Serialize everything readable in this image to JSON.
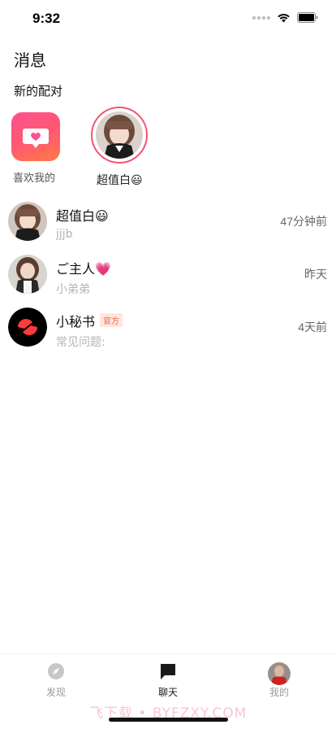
{
  "status_bar": {
    "time": "9:32"
  },
  "page": {
    "title": "消息"
  },
  "new_matches": {
    "section_title": "新的配对",
    "likes_label": "喜欢我的",
    "match_name": "超值白😃"
  },
  "chats": [
    {
      "name": "超值白😃",
      "preview": "jjjb",
      "time": "47分钟前"
    },
    {
      "name": "ご主人💗",
      "preview": "小弟弟",
      "time": "昨天"
    },
    {
      "name": "小秘书",
      "badge": "官方",
      "preview": "常见问题:",
      "time": "4天前"
    }
  ],
  "tab_bar": {
    "tabs": [
      {
        "label": "发现"
      },
      {
        "label": "聊天"
      },
      {
        "label": "我的"
      }
    ]
  },
  "watermark": "飞下载 • BYFZXY.COM",
  "colors": {
    "accent_pink": "#ff4f8f",
    "accent_orange": "#ff7b45",
    "ring": "#f2556b"
  }
}
